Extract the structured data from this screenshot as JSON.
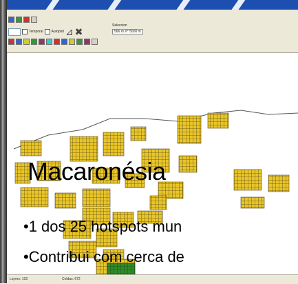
{
  "window": {
    "toolbar": {
      "checkbox_1": "Temporal",
      "checkbox_2": "Autoplot",
      "selection_label": "Seleccion",
      "selection_value": "566 m X° 5000 m"
    },
    "statusbar": {
      "left": "Layers: 102",
      "middle": "Celdas: 672"
    }
  },
  "slide": {
    "title": "Macaronésia",
    "bullets": [
      "•1 dos 25 hotspots mun",
      "•Contribui com cerca de"
    ]
  },
  "colors": {
    "title_band": "#1c4fb0",
    "toolbar_bg": "#ece9d8",
    "map_fill": "#e8c52a",
    "map_grid": "#5a4a12",
    "map_green": "#2f8a2a"
  }
}
